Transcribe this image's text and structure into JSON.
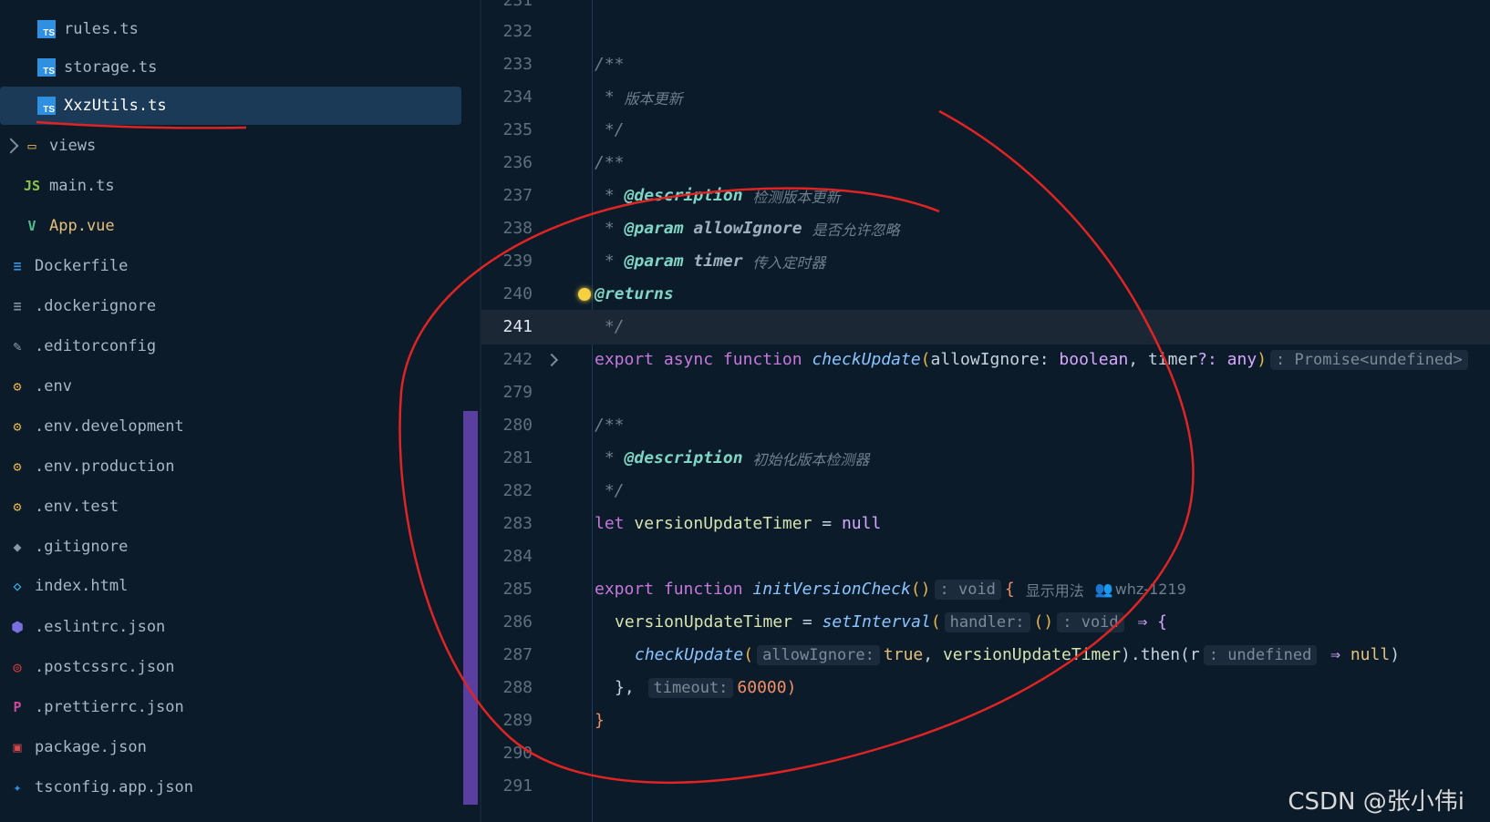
{
  "sidebar": {
    "items": [
      {
        "label": "rules.ts",
        "icon": "typescript-file-icon",
        "indent": 1,
        "color": "#a8b7c6"
      },
      {
        "label": "storage.ts",
        "icon": "typescript-file-icon",
        "indent": 1,
        "color": "#a8b7c6"
      },
      {
        "label": "XxzUtils.ts",
        "icon": "typescript-file-icon",
        "indent": 1,
        "selected": true,
        "color": "#ffffff"
      },
      {
        "label": "views",
        "icon": "folder-icon",
        "indent": 0,
        "folder": true,
        "color": "#a8b7c6"
      },
      {
        "label": "main.ts",
        "icon": "javascript-file-icon",
        "indent": 0,
        "color": "#a8b7c6"
      },
      {
        "label": "App.vue",
        "icon": "vue-file-icon",
        "indent": 0,
        "color": "#e5c07b"
      },
      {
        "label": "Dockerfile",
        "icon": "docker-icon",
        "indent": -1,
        "color": "#a8b7c6"
      },
      {
        "label": ".dockerignore",
        "icon": "docker-ignore-icon",
        "indent": -1,
        "color": "#a8b7c6"
      },
      {
        "label": ".editorconfig",
        "icon": "editorconfig-icon",
        "indent": -1,
        "color": "#a8b7c6"
      },
      {
        "label": ".env",
        "icon": "env-settings-icon",
        "indent": -1,
        "color": "#a8b7c6"
      },
      {
        "label": ".env.development",
        "icon": "env-settings-icon",
        "indent": -1,
        "color": "#a8b7c6"
      },
      {
        "label": ".env.production",
        "icon": "env-settings-icon",
        "indent": -1,
        "color": "#a8b7c6"
      },
      {
        "label": ".env.test",
        "icon": "env-settings-icon",
        "indent": -1,
        "color": "#a8b7c6"
      },
      {
        "label": ".gitignore",
        "icon": "git-icon",
        "indent": -1,
        "color": "#a8b7c6"
      },
      {
        "label": "index.html",
        "icon": "html-file-icon",
        "indent": -1,
        "color": "#a8b7c6"
      },
      {
        "label": ".eslintrc.json",
        "icon": "eslint-icon",
        "indent": -1,
        "color": "#a8b7c6"
      },
      {
        "label": ".postcssrc.json",
        "icon": "postcss-icon",
        "indent": -1,
        "color": "#a8b7c6"
      },
      {
        "label": ".prettierrc.json",
        "icon": "prettier-icon",
        "indent": -1,
        "color": "#a8b7c6"
      },
      {
        "label": "package.json",
        "icon": "npm-package-icon",
        "indent": -1,
        "color": "#a8b7c6"
      },
      {
        "label": "tsconfig.app.json",
        "icon": "tsconfig-icon",
        "indent": -1,
        "color": "#a8b7c6"
      }
    ]
  },
  "editor": {
    "current_line": "241",
    "line_numbers": [
      "232",
      "233",
      "234",
      "235",
      "236",
      "237",
      "238",
      "239",
      "240",
      "241",
      "242",
      "279",
      "280",
      "281",
      "282",
      "283",
      "284",
      "285",
      "286",
      "287",
      "288",
      "289",
      "290"
    ],
    "top_partial_line": "231",
    "bottom_partial_line": "291",
    "code": {
      "l233": "/**",
      "l234_star": " * ",
      "l234_text": "版本更新",
      "l235": " */",
      "l236": "/**",
      "l237_star": " * ",
      "l237_tag": "@description",
      "l237_text": "检测版本更新",
      "l238_star": " * ",
      "l238_tag": "@param",
      "l238_param": "allowIgnore",
      "l238_text": "是否允许忽略",
      "l239_star": " * ",
      "l239_tag": "@param",
      "l239_param": "timer",
      "l239_text": "传入定时器",
      "l240_tag": "@returns",
      "l241": " */",
      "l242_export": "export",
      "l242_async": "async",
      "l242_function": "function",
      "l242_name": "checkUpdate",
      "l242_open": "(",
      "l242_p1": "allowIgnore",
      "l242_colon1": ": ",
      "l242_t1": "boolean",
      "l242_comma": ", ",
      "l242_p2": "timer",
      "l242_q": "?: ",
      "l242_t2": "any",
      "l242_close": ")",
      "l242_hint": ": Promise<undefined>",
      "l280": "/**",
      "l281_star": " * ",
      "l281_tag": "@description",
      "l281_text": "初始化版本检测器",
      "l282": " */",
      "l283_let": "let",
      "l283_name": "versionUpdateTimer",
      "l283_eq": " = ",
      "l283_null": "null",
      "l285_export": "export",
      "l285_function": "function",
      "l285_name": "initVersionCheck",
      "l285_paren": "()",
      "l285_hint": ": void",
      "l285_brace": "{",
      "l285_usage": "显示用法",
      "l285_author": "whz-1219",
      "l286_name": "versionUpdateTimer",
      "l286_eq": " = ",
      "l286_fn": "setInterval",
      "l286_open": "(",
      "l286_hint1": "handler:",
      "l286_paren": "()",
      "l286_hint2": ": void",
      "l286_arrow": "⇒ {",
      "l287_fn": "checkUpdate",
      "l287_open": "(",
      "l287_hint": "allowIgnore:",
      "l287_true": "true",
      "l287_comma": ", ",
      "l287_var": "versionUpdateTimer",
      "l287_then": ").then(",
      "l287_r": "r",
      "l287_hint2": ": undefined",
      "l287_arrow": "⇒ ",
      "l287_null": "null",
      "l287_close": ")",
      "l288_brace": "},",
      "l288_hint": "timeout:",
      "l288_num": "60000",
      "l288_close": ")",
      "l289": "}"
    }
  },
  "watermark": "CSDN @张小伟i"
}
